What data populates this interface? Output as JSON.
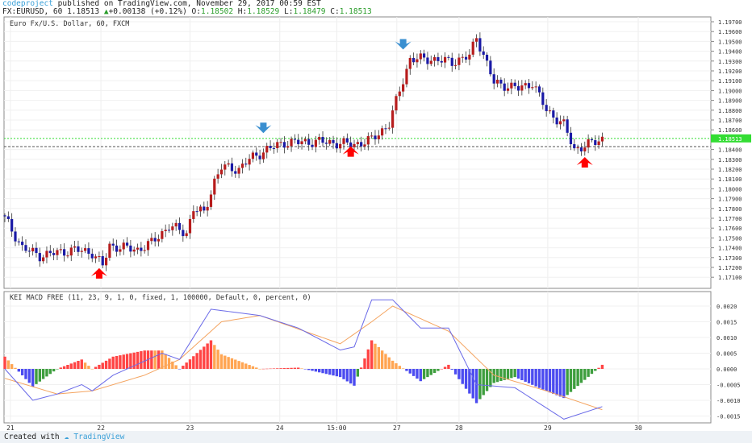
{
  "header": {
    "user": "codeproject",
    "published": "published on TradingView.com, November 29, 2017 00:59 EST",
    "symbol": "FX:EURUSD, 60 1.18513",
    "change": "+0.00138 (+0.12%)",
    "o_label": "O:",
    "o": "1.18502",
    "h_label": "H:",
    "h": "1.18529",
    "l_label": "L:",
    "l": "1.18479",
    "c_label": "C:",
    "c": "1.18513"
  },
  "footer": {
    "created": "Created with",
    "brand": "TradingView"
  },
  "colors": {
    "up": "#b71c1c",
    "down": "#1a1aa6",
    "price_line": "#33dd33",
    "macd": "#6a6ae8",
    "signal": "#f4a460",
    "hist_up_rising": "#f44",
    "hist_up_falling": "#ffa552",
    "hist_dn_falling": "#4b4bf0",
    "hist_dn_rising": "#3e9e3e",
    "arrow_up": "#f00",
    "arrow_down": "#3a8fd0"
  },
  "chart_data": [
    {
      "type": "candlestick",
      "title": "Euro Fx/U.S. Dollar, 60, FXCM",
      "ylim": [
        1.17,
        1.1975
      ],
      "yticks": [
        "1.19700",
        "1.19600",
        "1.19500",
        "1.19400",
        "1.19300",
        "1.19200",
        "1.19100",
        "1.19000",
        "1.18900",
        "1.18800",
        "1.18700",
        "1.18600",
        "1.18400",
        "1.18300",
        "1.18200",
        "1.18100",
        "1.18000",
        "1.17900",
        "1.17800",
        "1.17700",
        "1.17600",
        "1.17500",
        "1.17400",
        "1.17300",
        "1.17200",
        "1.17100"
      ],
      "current_price": "1.18513",
      "support_level": 1.1843,
      "close_path": [
        [
          0,
          1.177
        ],
        [
          5,
          1.174
        ],
        [
          10,
          1.1732
        ],
        [
          20,
          1.1738
        ],
        [
          25,
          1.1735
        ],
        [
          28,
          1.1722
        ],
        [
          30,
          1.1742
        ],
        [
          38,
          1.1738
        ],
        [
          42,
          1.1745
        ],
        [
          47,
          1.1762
        ],
        [
          52,
          1.1755
        ],
        [
          54,
          1.178
        ],
        [
          57,
          1.1775
        ],
        [
          60,
          1.1808
        ],
        [
          62,
          1.1822
        ],
        [
          67,
          1.182
        ],
        [
          70,
          1.183
        ],
        [
          75,
          1.184
        ],
        [
          80,
          1.1847
        ],
        [
          90,
          1.1848
        ],
        [
          100,
          1.1845
        ],
        [
          105,
          1.185
        ],
        [
          110,
          1.1866
        ],
        [
          113,
          1.19
        ],
        [
          116,
          1.1932
        ],
        [
          122,
          1.1932
        ],
        [
          128,
          1.1929
        ],
        [
          133,
          1.1935
        ],
        [
          135,
          1.1955
        ],
        [
          140,
          1.1908
        ],
        [
          147,
          1.1902
        ],
        [
          151,
          1.1908
        ],
        [
          155,
          1.188
        ],
        [
          160,
          1.1865
        ],
        [
          163,
          1.184
        ],
        [
          167,
          1.1845
        ],
        [
          171,
          1.1851
        ]
      ],
      "arrows": [
        {
          "bar": 27,
          "dir": "up",
          "price": 1.1716
        },
        {
          "bar": 74,
          "dir": "down",
          "price": 1.186
        },
        {
          "bar": 99,
          "dir": "up",
          "price": 1.184
        },
        {
          "bar": 114,
          "dir": "down",
          "price": 1.1945
        },
        {
          "bar": 166,
          "dir": "up",
          "price": 1.1829
        }
      ]
    },
    {
      "type": "line+bar",
      "title": "KEI MACD FREE (11, 23, 9, 1, 0, fixed, 1, 100000, Default, 0, percent, 0)",
      "ylim": [
        -0.0018,
        0.0023
      ],
      "yticks": [
        "0.0020",
        "0.0015",
        "0.0010",
        "0.0005",
        "0.0000",
        "-0.0005",
        "-0.0010",
        "-0.0015"
      ],
      "ytick_values": [
        0.002,
        0.0015,
        0.001,
        0.0005,
        0,
        -0.0005,
        -0.001,
        -0.0015
      ],
      "macd": [
        [
          0,
          0
        ],
        [
          8,
          -0.001
        ],
        [
          15,
          -0.0008
        ],
        [
          22,
          -0.0005
        ],
        [
          25,
          -0.0007
        ],
        [
          31,
          -0.0002
        ],
        [
          45,
          0.0005
        ],
        [
          50,
          0.0003
        ],
        [
          59,
          0.0019
        ],
        [
          66,
          0.0018
        ],
        [
          73,
          0.0017
        ],
        [
          84,
          0.0013
        ],
        [
          96,
          0.0006
        ],
        [
          100,
          0.0007
        ],
        [
          105,
          0.0022
        ],
        [
          111,
          0.0022
        ],
        [
          119,
          0.0013
        ],
        [
          127,
          0.0013
        ],
        [
          135,
          -0.0005
        ],
        [
          146,
          -0.0006
        ],
        [
          160,
          -0.0016
        ],
        [
          171,
          -0.0012
        ]
      ],
      "signal": [
        [
          0,
          -0.0003
        ],
        [
          15,
          -0.0008
        ],
        [
          25,
          -0.0007
        ],
        [
          40,
          -0.0002
        ],
        [
          50,
          0.0003
        ],
        [
          62,
          0.0015
        ],
        [
          73,
          0.0017
        ],
        [
          96,
          0.0008
        ],
        [
          105,
          0.0015
        ],
        [
          111,
          0.002
        ],
        [
          127,
          0.0012
        ],
        [
          140,
          -0.0002
        ],
        [
          155,
          -0.0007
        ],
        [
          171,
          -0.0013
        ]
      ]
    },
    {
      "type": "axis",
      "xticks": [
        {
          "label": "21",
          "bar": 1.6
        },
        {
          "label": "22",
          "bar": 27.5
        },
        {
          "label": "23",
          "bar": 53
        },
        {
          "label": "24",
          "bar": 78.7
        },
        {
          "label": "15:00",
          "bar": 95
        },
        {
          "label": "27",
          "bar": 112.2
        },
        {
          "label": "28",
          "bar": 130
        },
        {
          "label": "29",
          "bar": 155.4
        },
        {
          "label": "30",
          "bar": 181.3
        }
      ]
    }
  ]
}
